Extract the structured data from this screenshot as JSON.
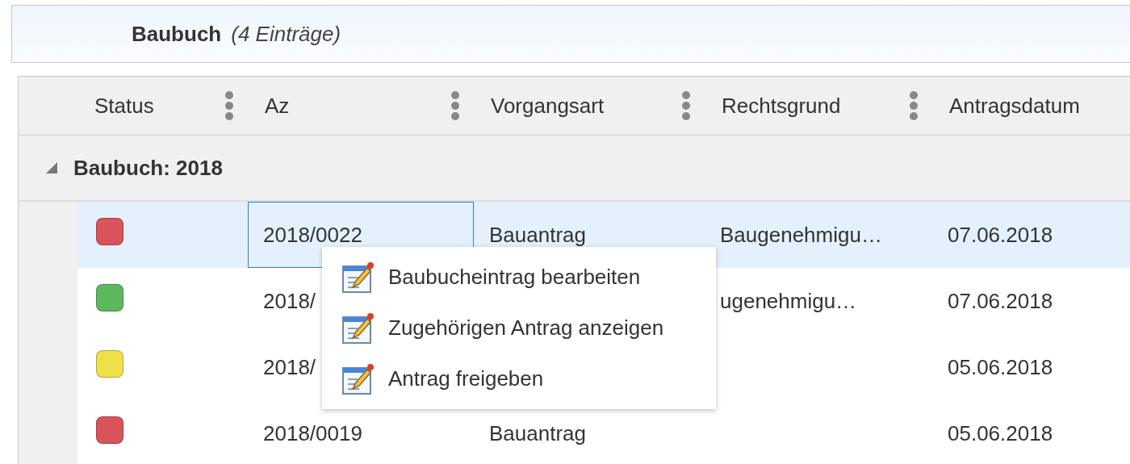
{
  "panel": {
    "title": "Baubuch",
    "count": "(4 Einträge)"
  },
  "table": {
    "columns": [
      "Status",
      "Az",
      "Vorgangsart",
      "Rechtsgrund",
      "Antragsdatum"
    ],
    "groups": [
      {
        "label": "Baubuch: 2018",
        "expanded": true,
        "rows": [
          {
            "color": "#d9535a",
            "az": "2018/0022",
            "vorgangsart": "Bauantrag",
            "rechtsgrund": "Baugenehmigu…",
            "datum": "07.06.2018",
            "selected": true
          },
          {
            "color": "#5cb85c",
            "az": "2018/",
            "vorgangsart": "",
            "rechtsgrund": "ugenehmigu…",
            "datum": "07.06.2018",
            "selected": false
          },
          {
            "color": "#eee04a",
            "az": "2018/",
            "vorgangsart": "",
            "rechtsgrund": "",
            "datum": "05.06.2018",
            "selected": false
          },
          {
            "color": "#d9535a",
            "az": "2018/0019",
            "vorgangsart": "Bauantrag",
            "rechtsgrund": "",
            "datum": "05.06.2018",
            "selected": false
          }
        ]
      }
    ]
  },
  "context_menu": {
    "items": [
      "Baubucheintrag bearbeiten",
      "Zugehörigen Antrag anzeigen",
      "Antrag freigeben"
    ]
  }
}
